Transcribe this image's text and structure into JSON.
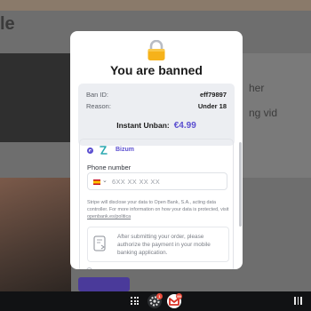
{
  "background": {
    "title_partial": "le",
    "right_text_1": "her",
    "right_text_2": "ng vid"
  },
  "modal": {
    "title": "You are banned",
    "lock_icon": "lock-icon",
    "ban_id_label": "Ban ID:",
    "ban_id_value": "eff79897",
    "reason_label": "Reason:",
    "reason_value": "Under 18",
    "unban_label": "Instant Unban:",
    "unban_price": "€4.99",
    "payment": {
      "method_label": "Bizum",
      "method_icon": "bizum-icon",
      "phone_label": "Phone number",
      "phone_placeholder": "6XX XX XX XX",
      "country_flag": "spain-flag",
      "disclaimer": "Stripe will disclose your data to Open Bank, S.A., acting data controller. For more information on how your data is protected, visit",
      "disclaimer_link": "openbank.es/politica",
      "info_text": "After submitting your order, please authorize the payment in your mobile banking application."
    },
    "colors": {
      "accent": "#5b4fd0",
      "bizum": "#2aa8b0"
    }
  },
  "taskbar": {
    "apps": [
      {
        "name": "settings-icon",
        "badge": "1"
      },
      {
        "name": "gmail-icon",
        "badge": "99"
      }
    ]
  }
}
